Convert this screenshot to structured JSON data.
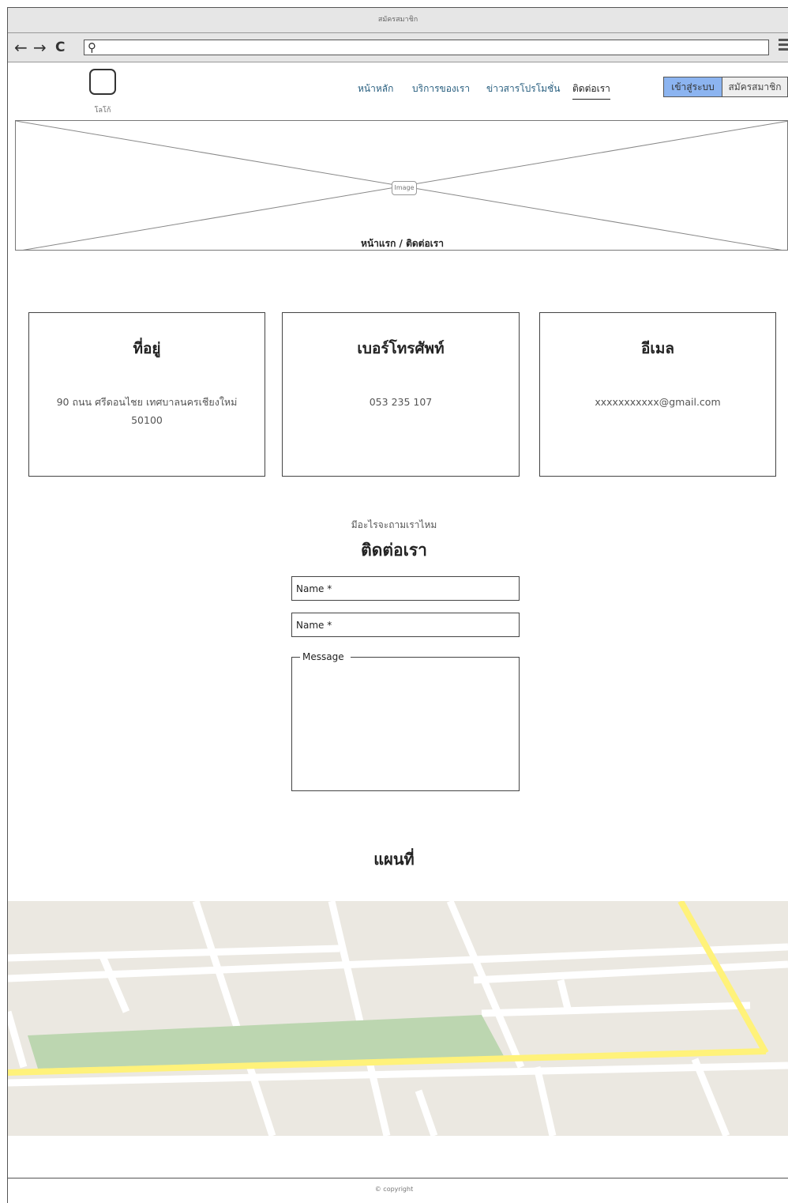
{
  "window": {
    "title": "สมัครสมาชิก"
  },
  "browser": {
    "back": "←",
    "forward": "→",
    "reload": "C",
    "search_icon": "search-icon",
    "menu_icon": "hamburger-icon"
  },
  "header": {
    "logo_label": "โลโก้",
    "nav": [
      "หน้าหลัก",
      "บริการของเรา",
      "ข่าวสารโปรโมชั่น",
      "ติดต่อเรา"
    ],
    "active_nav": "ติดต่อเรา",
    "login_label": "เข้าสู่ระบบ",
    "register_label": "สมัครสมาชิก",
    "login_color": "#8cb4f0"
  },
  "hero": {
    "image_label": "Image",
    "breadcrumb": "หน้าแรก / ติดต่อเรา"
  },
  "cards": [
    {
      "title": "ที่อยู่",
      "value": "90 ถนน ศรีดอนไชย เทศบาลนครเชียงใหม่ 50100"
    },
    {
      "title": "เบอร์โทรศัพท์",
      "value": "053 235 107"
    },
    {
      "title": "อีเมล",
      "value": "xxxxxxxxxxx@gmail.com"
    }
  ],
  "contact": {
    "subtitle": "มีอะไรจะถามเราไหม",
    "title": "ติดต่อเรา",
    "field1": "Name *",
    "field2": "Name *",
    "message_label": "Message"
  },
  "map": {
    "title": "แผนที่",
    "road_color": "#fff27a",
    "park_color": "#bcd6b0"
  },
  "footer": {
    "copyright": "© copyright"
  }
}
